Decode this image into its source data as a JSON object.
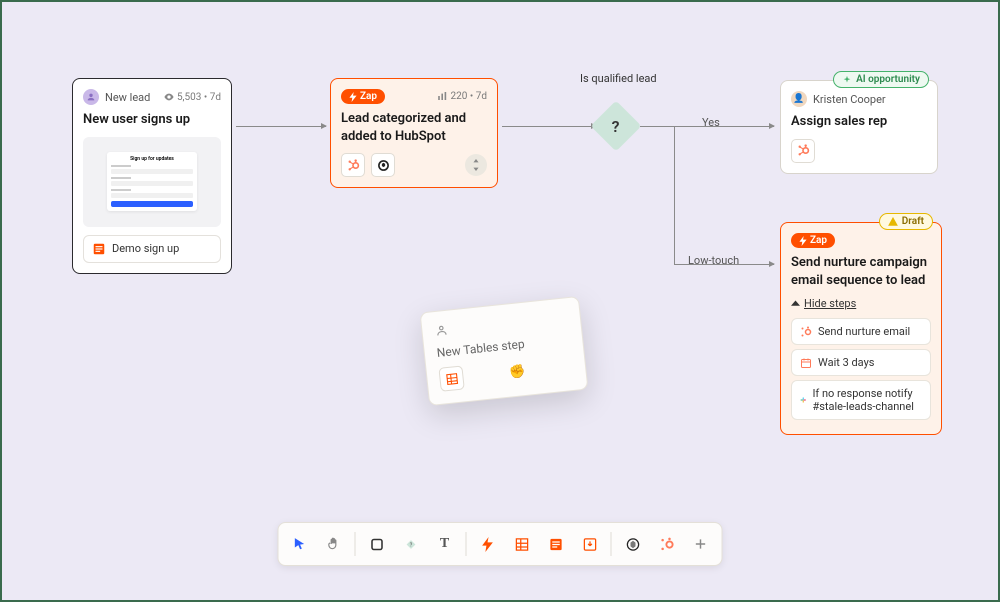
{
  "cards": {
    "newLead": {
      "tag": "New lead",
      "views": "5,503",
      "age": "7d",
      "title": "New user signs up",
      "formTitle": "Sign up for updates",
      "chip": "Demo sign up"
    },
    "categorize": {
      "badge": "Zap",
      "stat": "220",
      "age": "7d",
      "title": "Lead categorized and added to HubSpot"
    },
    "decision": {
      "label": "Is qualified lead",
      "symbol": "?",
      "yes": "Yes",
      "low": "Low-touch"
    },
    "assign": {
      "badge": "AI opportunity",
      "owner": "Kristen Cooper",
      "title": "Assign sales rep"
    },
    "nurture": {
      "badge": "Zap",
      "draft": "Draft",
      "title": "Send nurture campaign email sequence to lead",
      "hideSteps": "Hide steps",
      "steps": [
        "Send nurture email",
        "Wait 3 days",
        "If no response notify #stale-leads-channel"
      ]
    },
    "floating": {
      "title": "New Tables step"
    }
  },
  "toolbar": {
    "items": [
      "cursor",
      "hand",
      "sep",
      "square",
      "help",
      "text",
      "sep",
      "bolt",
      "table",
      "form",
      "import",
      "sep",
      "openai",
      "hubspot",
      "plus"
    ]
  },
  "icons": {
    "hubspot": "#ff7a59",
    "openai": "#222",
    "slack": "#611f69",
    "table": "#ff4f00",
    "form": "#ff4f00"
  }
}
